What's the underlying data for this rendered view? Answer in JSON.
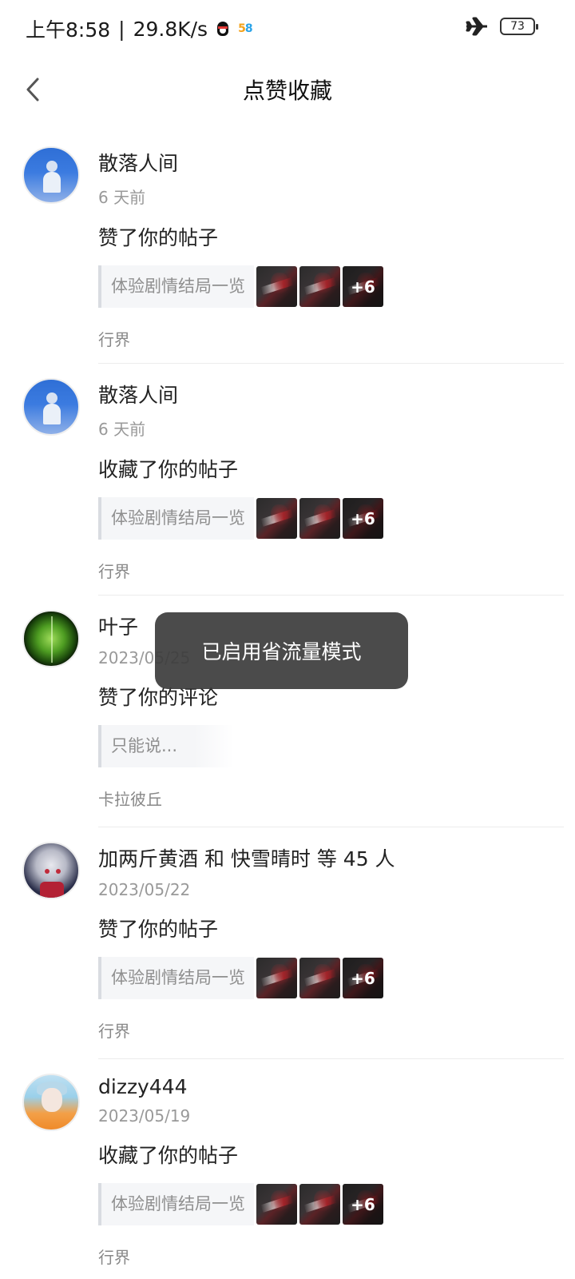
{
  "status_bar": {
    "time": "上午8:58",
    "separator": "|",
    "network_speed": "29.8K/s",
    "icons": [
      "qq-icon",
      "58-app-icon",
      "airplane-mode-icon"
    ],
    "badge_58": {
      "c5": "5",
      "c8": "8"
    },
    "battery": "73"
  },
  "nav": {
    "back_icon": "chevron-left-icon",
    "title": "点赞收藏"
  },
  "items": [
    {
      "name": "散落人间",
      "time": "6 天前",
      "action": "赞了你的帖子",
      "card_text": "体验剧情结局一览",
      "more": "+6",
      "tag": "行界"
    },
    {
      "name": "散落人间",
      "time": "6 天前",
      "action": "收藏了你的帖子",
      "card_text": "体验剧情结局一览",
      "more": "+6",
      "tag": "行界"
    },
    {
      "name": "叶子",
      "time": "2023/05/25",
      "action": "赞了你的评论",
      "card_text": "只能说...",
      "tag": "卡拉彼丘"
    },
    {
      "name": "加两斤黄酒 和 快雪晴时 等 45 人",
      "time": "2023/05/22",
      "action": "赞了你的帖子",
      "card_text": "体验剧情结局一览",
      "more": "+6",
      "tag": "行界"
    },
    {
      "name": "dizzy444",
      "time": "2023/05/19",
      "action": "收藏了你的帖子",
      "card_text": "体验剧情结局一览",
      "more": "+6",
      "tag": "行界"
    }
  ],
  "toast": "已启用省流量模式"
}
